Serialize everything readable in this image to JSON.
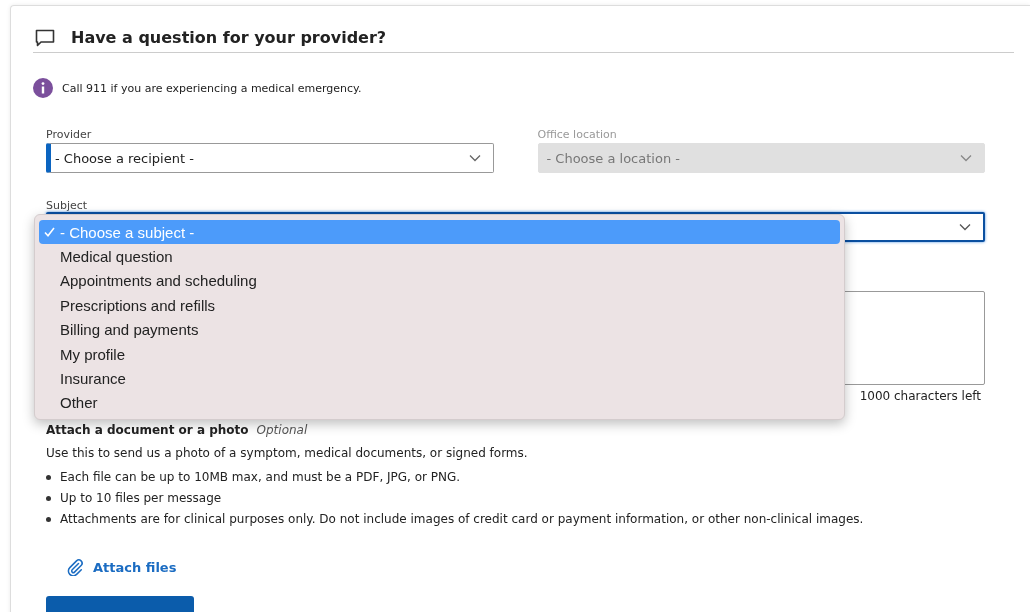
{
  "header": {
    "title": "Have a question for your provider?"
  },
  "notice": {
    "text": "Call 911 if you are experiencing a medical emergency."
  },
  "provider": {
    "label": "Provider",
    "value": "- Choose a recipient -",
    "disabled": false
  },
  "office_location": {
    "label": "Office location",
    "value": "- Choose a location -",
    "disabled": true
  },
  "subject": {
    "label": "Subject",
    "expanded": true,
    "options": [
      {
        "label": "- Choose a subject -",
        "selected": true
      },
      {
        "label": "Medical question",
        "selected": false
      },
      {
        "label": "Appointments and scheduling",
        "selected": false
      },
      {
        "label": "Prescriptions and refills",
        "selected": false
      },
      {
        "label": "Billing and payments",
        "selected": false
      },
      {
        "label": "My profile",
        "selected": false
      },
      {
        "label": "Insurance",
        "selected": false
      },
      {
        "label": "Other",
        "selected": false
      }
    ]
  },
  "message": {
    "counter": "1000 characters left"
  },
  "attachments": {
    "title": "Attach a document or a photo",
    "optional_tag": "Optional",
    "description": "Use this to send us a photo of a symptom, medical documents, or signed forms.",
    "bullets": [
      "Each file can be up to 10MB max, and must be a PDF, JPG, or PNG.",
      "Up to 10 files per message",
      "Attachments are for clinical purposes only. Do not include images of credit card or payment information, or other non-clinical images."
    ],
    "attach_link": "Attach files"
  }
}
